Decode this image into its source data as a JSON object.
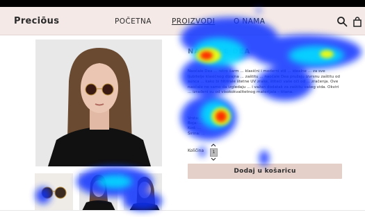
{
  "brand": {
    "logo_text": "Preciōus"
  },
  "nav": {
    "items": [
      {
        "label": "POČETNA"
      },
      {
        "label": "PROIZVODI"
      },
      {
        "label": "O NAMA"
      }
    ],
    "icons": [
      "search-icon",
      "shopping-bag-icon"
    ]
  },
  "product": {
    "title": "NAOČALE DEA",
    "price": "",
    "description": "Naočale Dea ... retro šarm ... klasični i moderni stil ... idealne ... za sve ljubitelje klasičnog dizajna ... zaštitu ... naočale Dea pružaju izvrsnu zaštitu od sunca ... kako bi filtrirale štetne UV zrake, štiteći vaše oči od ... zračenja. Ove naočale ne samo da izgledaju ... i važan dodatak za zaštitu vašeg vida. Okviri ... izrađeni su od visokokvalitetnog materijala – titana.",
    "specs": [
      "Vrsta: ...",
      "Boja: ...",
      "Kod: ...",
      "Širina: ..."
    ],
    "quantity_label": "Količina",
    "quantity_value": "1",
    "add_to_cart_label": "Dodaj u košaricu"
  },
  "colors": {
    "header_bg": "#f4e9e6",
    "button_bg": "#e4cfc9",
    "text": "#2b2b2b"
  },
  "overlay": {
    "type": "attention-heatmap",
    "palette": [
      "#0000ff",
      "#00ffff",
      "#ffff00",
      "#ff0000"
    ]
  }
}
